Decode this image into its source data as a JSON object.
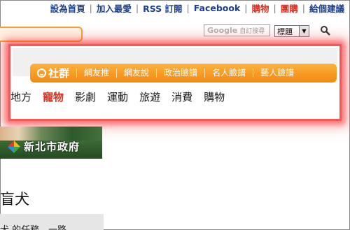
{
  "toplinks": [
    {
      "label": "設為首頁",
      "hot": false
    },
    {
      "label": "加入最愛",
      "hot": false
    },
    {
      "label": "RSS 訂閱",
      "hot": false
    },
    {
      "label": "Facebook",
      "hot": false
    },
    {
      "label": "購物",
      "hot": true
    },
    {
      "label": "團購",
      "hot": true
    },
    {
      "label": "給個建議",
      "hot": false
    }
  ],
  "search": {
    "google_label": "Google",
    "google_hint": "自訂搜尋",
    "select_value": "標題"
  },
  "popup": {
    "brand": "社群",
    "items": [
      "網友推",
      "網友說",
      "政治臉譜",
      "名人臉譜",
      "藝人臉譜"
    ],
    "categories": [
      "地方",
      "寵物",
      "影劇",
      "運動",
      "旅遊",
      "消費",
      "購物"
    ],
    "active_category": "寵物"
  },
  "banner": {
    "text": "新北市政府"
  },
  "article": {
    "title": "盲犬",
    "body": "犬 的任務，一路"
  },
  "colors": {
    "link_blue": "#1a3e8c",
    "hot_red": "#e0301e",
    "orange": "#f28a10",
    "glow_red": "#f05a5a"
  }
}
